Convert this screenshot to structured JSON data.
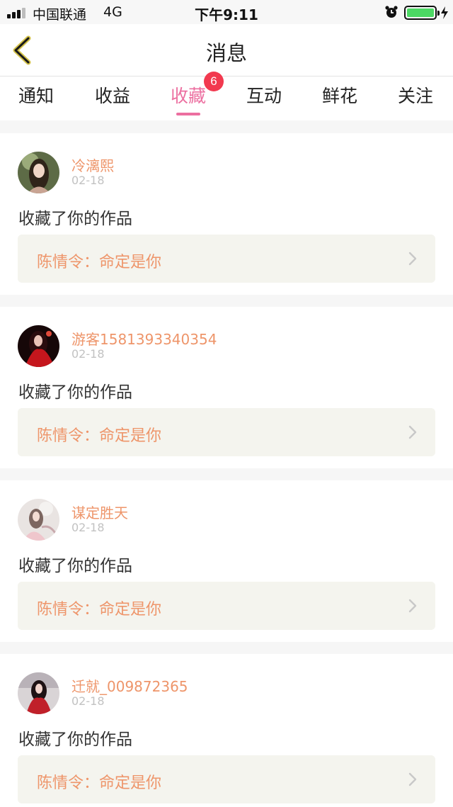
{
  "status_bar": {
    "carrier": "中国联通",
    "network": "4G",
    "time": "下午9:11"
  },
  "header": {
    "title": "消息"
  },
  "tabs": [
    {
      "label": "通知"
    },
    {
      "label": "收益"
    },
    {
      "label": "收藏",
      "active": true,
      "badge": "6"
    },
    {
      "label": "互动"
    },
    {
      "label": "鲜花"
    },
    {
      "label": "关注"
    }
  ],
  "feed": [
    {
      "user": "冷漓熙",
      "date": "02-18",
      "action": "收藏了你的作品",
      "work": "陈情令：命定是你"
    },
    {
      "user": "游客1581393340354",
      "date": "02-18",
      "action": "收藏了你的作品",
      "work": "陈情令：命定是你"
    },
    {
      "user": "谋定胜天",
      "date": "02-18",
      "action": "收藏了你的作品",
      "work": "陈情令：命定是你"
    },
    {
      "user": "迁就_009872365",
      "date": "02-18",
      "action": "收藏了你的作品",
      "work": "陈情令：命定是你"
    }
  ],
  "colors": {
    "accent_pink": "#ec6fa0",
    "username_orange": "#ee956a",
    "badge_red": "#f2394f",
    "battery_green": "#4cd964"
  }
}
